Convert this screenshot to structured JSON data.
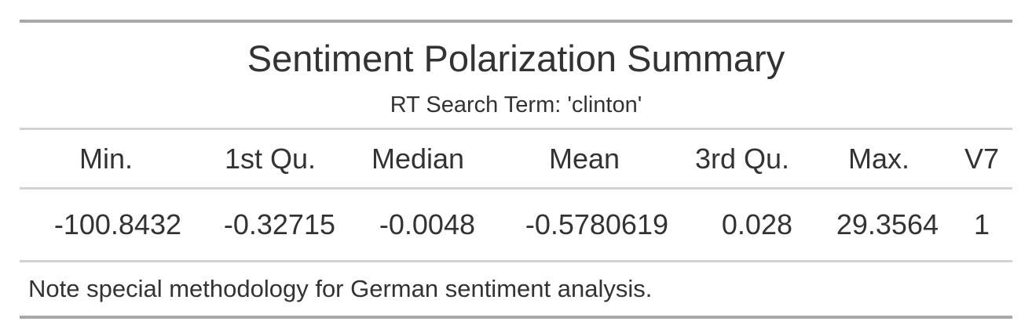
{
  "table": {
    "title": "Sentiment Polarization Summary",
    "subtitle": "RT Search Term: 'clinton'",
    "columns": [
      "Min.",
      "1st Qu.",
      "Median",
      "Mean",
      "3rd Qu.",
      "Max.",
      "V7"
    ],
    "rows": [
      [
        "-100.8432",
        "-0.32715",
        "-0.0048",
        "-0.5780619",
        "0.028",
        "29.3564",
        "1"
      ]
    ],
    "note": "Note special methodology for German sentiment analysis."
  },
  "colors": {
    "text": "#333333",
    "rule_thick": "#a8a8a8",
    "rule_thin": "#d3d3d3",
    "background": "#ffffff"
  }
}
